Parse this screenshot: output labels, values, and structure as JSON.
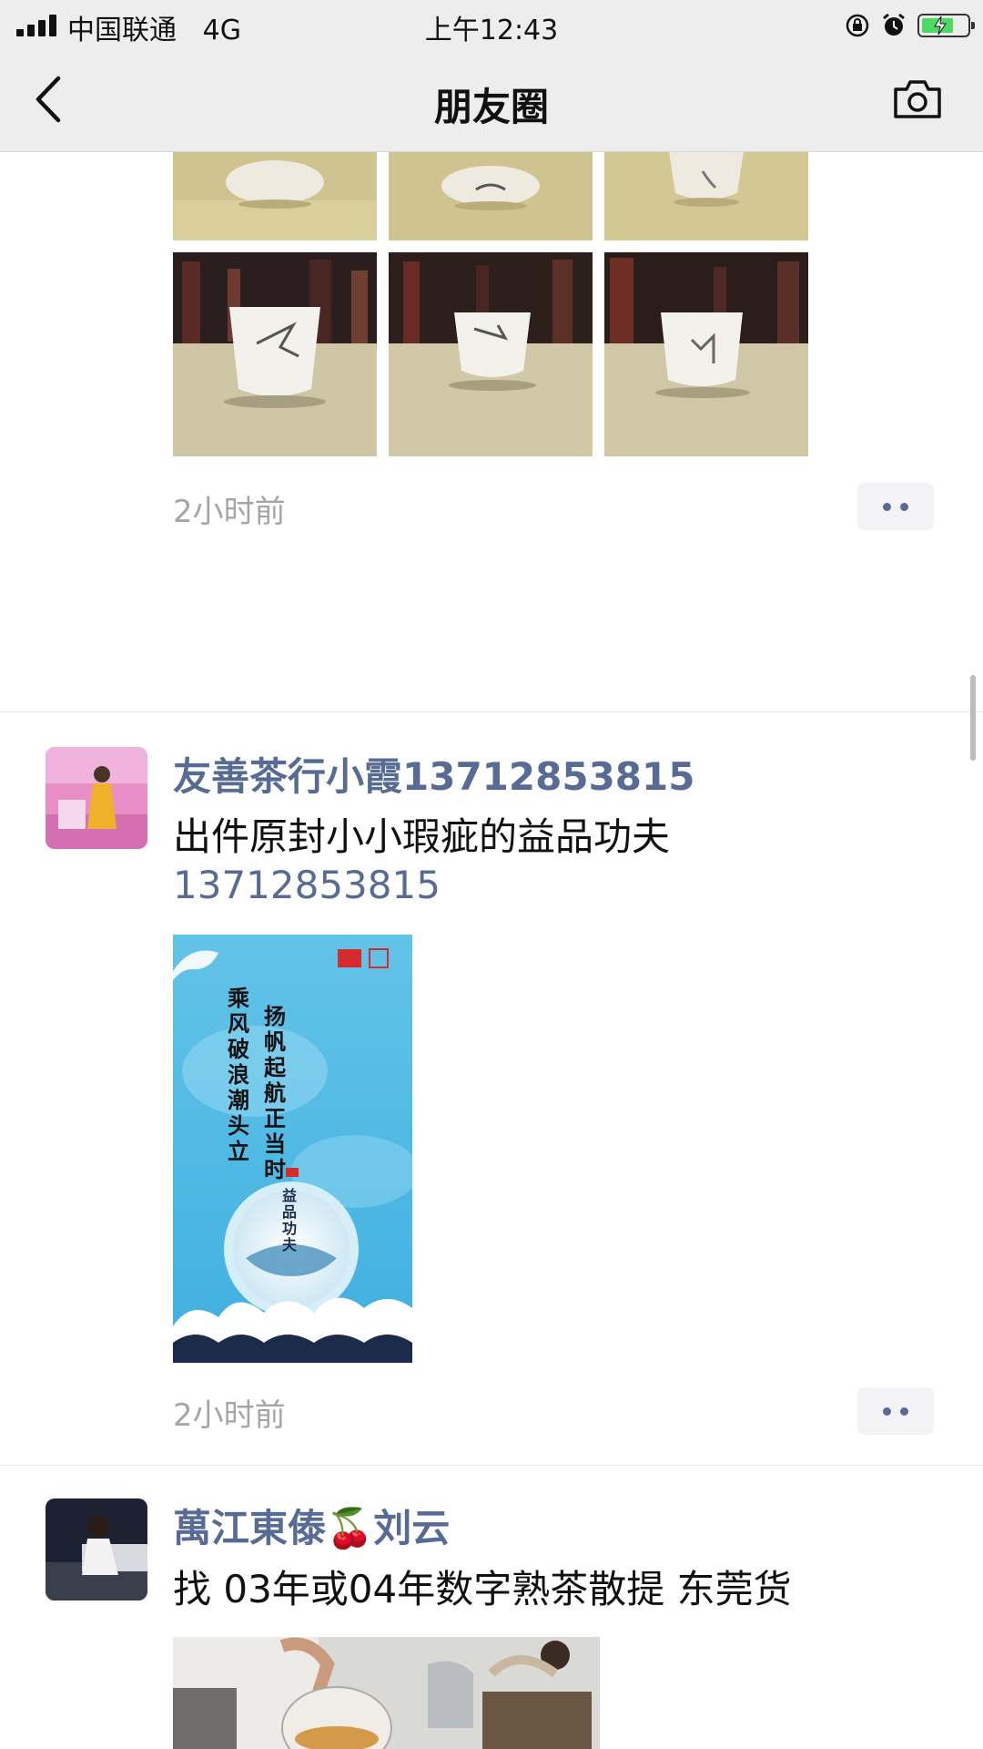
{
  "status_bar": {
    "carrier": "中国联通",
    "network": "4G",
    "time": "上午12:43"
  },
  "nav": {
    "title": "朋友圈",
    "back_icon": "chevron-left-icon",
    "camera_icon": "camera-icon"
  },
  "posts": [
    {
      "time": "2小时前",
      "photo_count": 9
    },
    {
      "author": "友善茶行小霞13712853815",
      "text": "出件原封小小瑕疵的益品功夫",
      "phone": "13712853815",
      "poster_text": {
        "col1": "扬帆起航正当时",
        "col2": "乘风破浪潮头立",
        "seal": "益品功夫"
      },
      "time": "2小时前"
    },
    {
      "author": "萬江東傣🍒刘云",
      "text": "找 03年或04年数字熟茶散提 东莞货"
    }
  ],
  "colors": {
    "link": "#576b95",
    "time": "#a5a5a5",
    "nav_bg": "#ededed"
  }
}
